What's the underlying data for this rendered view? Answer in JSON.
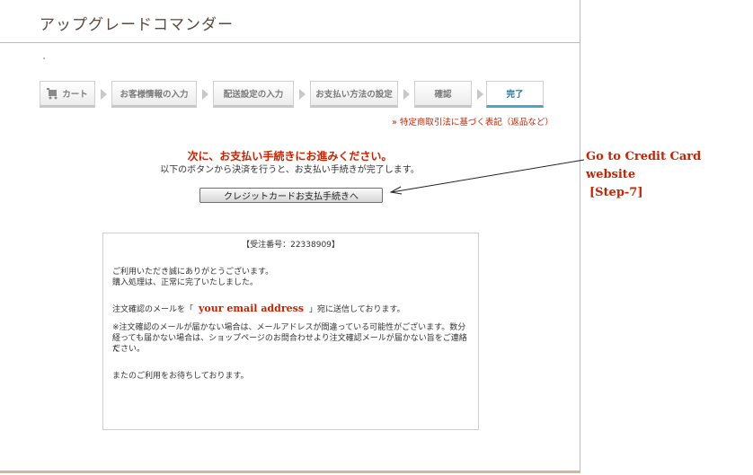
{
  "header": {
    "title": "アップグレードコマンダー"
  },
  "steps": [
    {
      "label": "カート",
      "icon": "cart-icon",
      "state": "inactive"
    },
    {
      "label": "お客様情報の入力",
      "state": "inactive"
    },
    {
      "label": "配送設定の入力",
      "state": "inactive"
    },
    {
      "label": "お支払い方法の設定",
      "state": "inactive"
    },
    {
      "label": "確認",
      "state": "inactive"
    },
    {
      "label": "完了",
      "state": "current"
    }
  ],
  "legal_link": "» 特定商取引法に基づく表記（返品など）",
  "notice": {
    "title": "次に、お支払い手続きにお進みください。",
    "subtitle": "以下のボタンから決済を行うと、お支払い手続きが完了します。"
  },
  "cc_button_label": "クレジットカードお支払手続きへ",
  "receipt": {
    "order_number": "【受注番号：22338909】",
    "thanks1": "ご利用いただき誠にありがとうございます。",
    "thanks2": "購入処理は、正常に完了いたしました。",
    "email_before": "注文確認のメールを「",
    "email_value": "your email address",
    "email_after": "」宛に送信しております。",
    "note1": "※注文確認のメールが届かない場合は、メールアドレスが間違っている可能性がございます。数分",
    "note2": "経っても届かない場合は、ショップページのお問合わせより注文確認メールが届かない旨をご連絡く",
    "note3": "ださい。",
    "closing": "またのご利用をお待ちしております。"
  },
  "annotation": {
    "line1": "Go to Credit Card website",
    "line2": "[Step-7]"
  },
  "colors": {
    "accent": "#cc2200",
    "step_current": "#4aa3c9",
    "border": "#c9b9aa"
  }
}
